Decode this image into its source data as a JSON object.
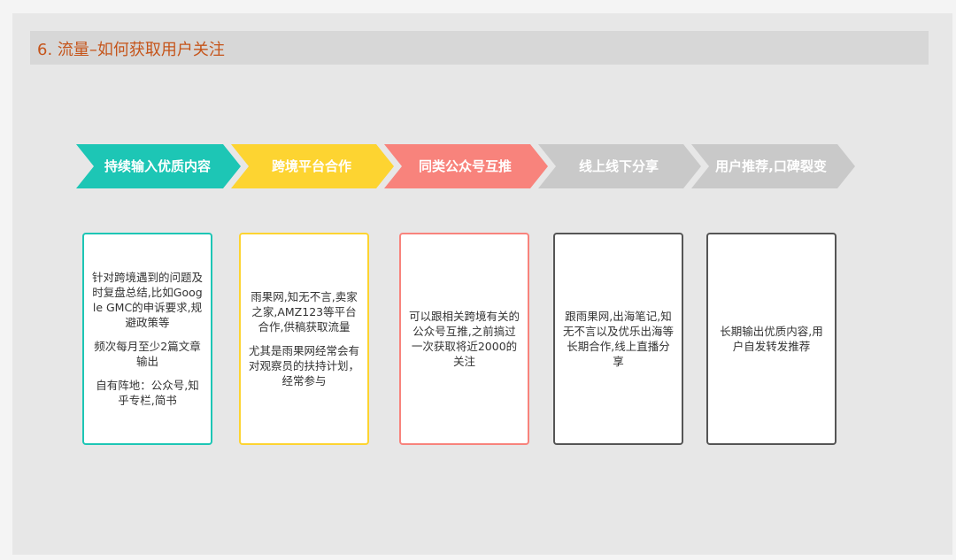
{
  "title": "6. 流量–如何获取用户关注",
  "steps": [
    {
      "label": "持续输入优质内容",
      "color": "#1dc6b5"
    },
    {
      "label": "跨境平台合作",
      "color": "#fdd431"
    },
    {
      "label": "同类公众号互推",
      "color": "#f8837c"
    },
    {
      "label": "线上线下分享",
      "color": "#c9c9c9"
    },
    {
      "label": "用户推荐,口碑裂变",
      "color": "#c9c9c9"
    }
  ],
  "cards": [
    {
      "border": "#1dc6b5",
      "paragraphs": [
        "针对跨境遇到的问题及时复盘总结,比如Google GMC的申诉要求,规避政策等",
        "频次每月至少2篇文章输出",
        "自有阵地：公众号,知乎专栏,简书"
      ]
    },
    {
      "border": "#fdd431",
      "paragraphs": [
        "雨果网,知无不言,卖家之家,AMZ123等平台合作,供稿获取流量",
        "尤其是雨果网经常会有对观察员的扶持计划，经常参与"
      ]
    },
    {
      "border": "#f8837c",
      "paragraphs": [
        "可以跟相关跨境有关的公众号互推,之前搞过一次获取将近2000的关注"
      ]
    },
    {
      "border": "#555555",
      "paragraphs": [
        "跟雨果网,出海笔记,知无不言以及优乐出海等长期合作,线上直播分享"
      ]
    },
    {
      "border": "#555555",
      "paragraphs": [
        "长期输出优质内容,用户自发转发推荐"
      ]
    }
  ]
}
